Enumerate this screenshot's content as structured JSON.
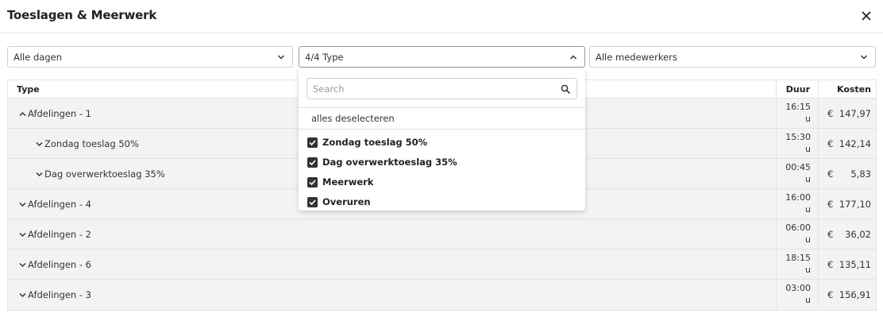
{
  "modal": {
    "title": "Toeslagen & Meerwerk"
  },
  "filters": {
    "days": "Alle dagen",
    "type": "4/4 Type",
    "employees": "Alle medewerkers"
  },
  "table": {
    "headers": {
      "type": "Type",
      "duur": "Duur",
      "kosten": "Kosten"
    },
    "rows": [
      {
        "name": "Afdelingen - 1",
        "expanded": true,
        "level": 0,
        "duur_time": "16:15",
        "duur_unit": "u",
        "currency": "€",
        "amount": "147,97"
      },
      {
        "name": "Zondag toeslag 50%",
        "expanded": false,
        "level": 1,
        "duur_time": "15:30",
        "duur_unit": "u",
        "currency": "€",
        "amount": "142,14"
      },
      {
        "name": "Dag overwerktoeslag 35%",
        "expanded": false,
        "level": 1,
        "duur_time": "00:45",
        "duur_unit": "u",
        "currency": "€",
        "amount": "5,83"
      },
      {
        "name": "Afdelingen - 4",
        "expanded": false,
        "level": 0,
        "duur_time": "16:00",
        "duur_unit": "u",
        "currency": "€",
        "amount": "177,10"
      },
      {
        "name": "Afdelingen - 2",
        "expanded": false,
        "level": 0,
        "duur_time": "06:00",
        "duur_unit": "u",
        "currency": "€",
        "amount": "36,02"
      },
      {
        "name": "Afdelingen - 6",
        "expanded": false,
        "level": 0,
        "duur_time": "18:15",
        "duur_unit": "u",
        "currency": "€",
        "amount": "135,11"
      },
      {
        "name": "Afdelingen - 3",
        "expanded": false,
        "level": 0,
        "duur_time": "03:00",
        "duur_unit": "u",
        "currency": "€",
        "amount": "156,91"
      }
    ]
  },
  "dropdown": {
    "search_placeholder": "Search",
    "deselect_label": "alles deselecteren",
    "options": [
      {
        "label": "Zondag toeslag 50%",
        "checked": true
      },
      {
        "label": "Dag overwerktoeslag 35%",
        "checked": true
      },
      {
        "label": "Meerwerk",
        "checked": true
      },
      {
        "label": "Overuren",
        "checked": true
      }
    ]
  }
}
